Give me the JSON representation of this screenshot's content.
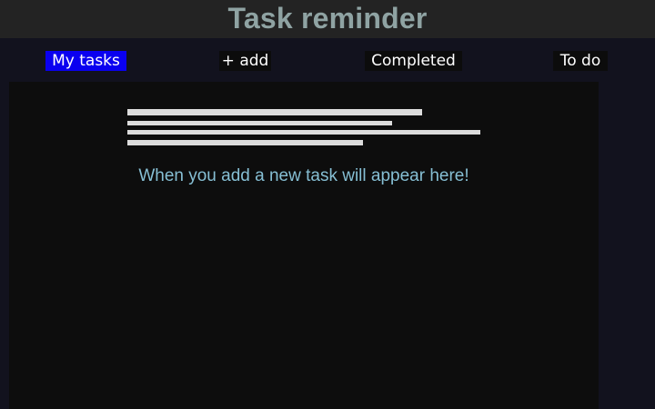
{
  "header": {
    "title": "Task reminder"
  },
  "nav": {
    "tabs": [
      {
        "label": "My tasks",
        "active": true
      },
      {
        "label": "+ add",
        "active": false
      },
      {
        "label": "Completed",
        "active": false
      },
      {
        "label": "To do",
        "active": false
      }
    ]
  },
  "main": {
    "empty_message": "When you add a new task will appear here!"
  },
  "colors": {
    "header_bg": "#232323",
    "title": "#8fa3a3",
    "active_tab": "#0a00f0",
    "page_bg": "#12121e",
    "panel_bg": "#0d0d0d",
    "message": "#86bfd4"
  }
}
